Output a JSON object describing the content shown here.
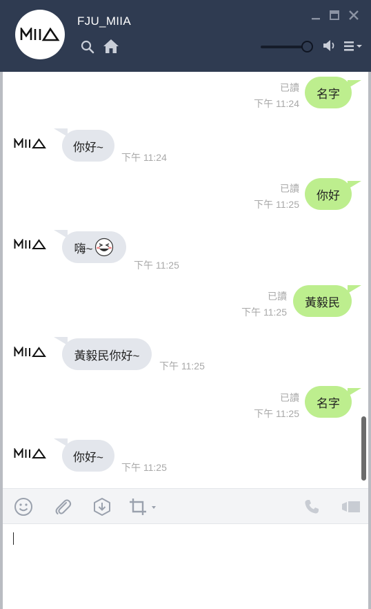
{
  "header": {
    "title": "FJU_MIIA",
    "avatar_logo": "MIIA",
    "icons": [
      "search-icon",
      "home-icon",
      "minimize-icon",
      "maximize-icon",
      "close-icon",
      "speaker-icon",
      "menu-icon"
    ]
  },
  "volume": 0.85,
  "messages": [
    {
      "dir": "out",
      "text": "名字",
      "read": "已讀",
      "time": "下午 11:24"
    },
    {
      "dir": "in",
      "text": "你好~",
      "time": "下午 11:24"
    },
    {
      "dir": "out",
      "text": "你好",
      "read": "已讀",
      "time": "下午 11:25"
    },
    {
      "dir": "in",
      "text": "嗨~",
      "time": "下午 11:25",
      "sticker": "laughing-face-icon"
    },
    {
      "dir": "out",
      "text": "黃毅民",
      "read": "已讀",
      "time": "下午 11:25"
    },
    {
      "dir": "in",
      "text": "黃毅民你好~",
      "time": "下午 11:25"
    },
    {
      "dir": "out",
      "text": "名字",
      "read": "已讀",
      "time": "下午 11:25"
    },
    {
      "dir": "in",
      "text": "你好~",
      "time": "下午 11:25"
    }
  ],
  "sender_logo": "MIIA",
  "toolbar": {
    "icons": [
      "emoji-icon",
      "attachment-icon",
      "download-icon",
      "crop-icon",
      "phone-icon",
      "video-icon"
    ]
  },
  "input": {
    "value": ""
  },
  "colors": {
    "header": "#2f3b51",
    "outgoing": "#bdee8e",
    "incoming": "#e3e6ec"
  }
}
